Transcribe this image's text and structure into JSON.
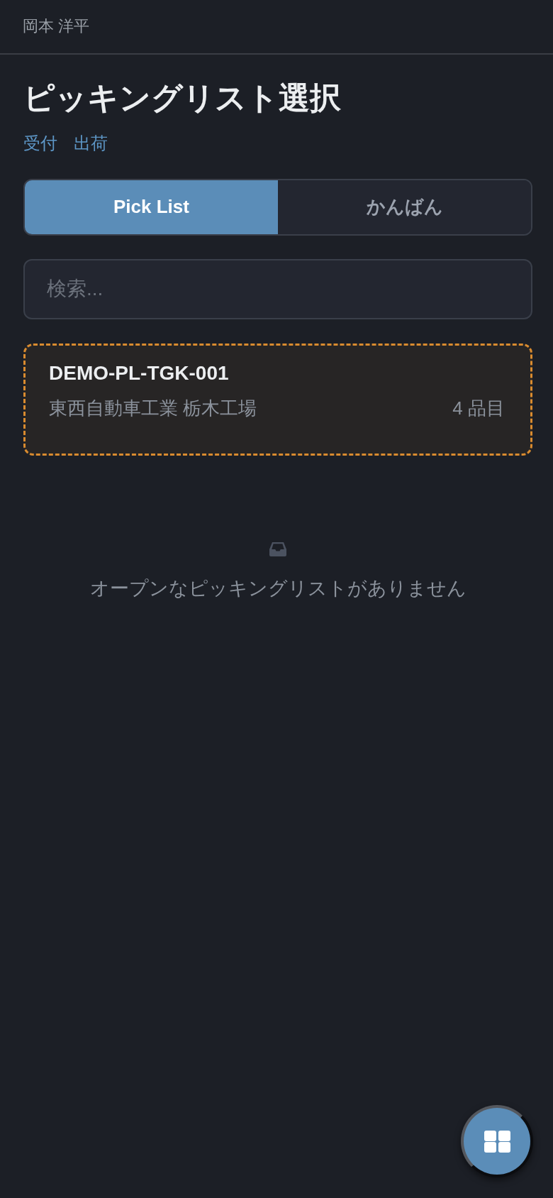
{
  "header": {
    "user_name": "岡本 洋平"
  },
  "page": {
    "title": "ピッキングリスト選択",
    "links": [
      {
        "label": "受付"
      },
      {
        "label": "出荷"
      }
    ]
  },
  "tabs": [
    {
      "label": "Pick List",
      "selected": true
    },
    {
      "label": "かんばん",
      "selected": false
    }
  ],
  "search": {
    "placeholder": "検索..."
  },
  "pick_lists": [
    {
      "code": "DEMO-PL-TGK-001",
      "customer": "東西自動車工業 栃木工場",
      "item_count": "4 品目",
      "highlighted": true
    }
  ],
  "empty_state": {
    "message": "オープンなピッキングリストがありません"
  }
}
